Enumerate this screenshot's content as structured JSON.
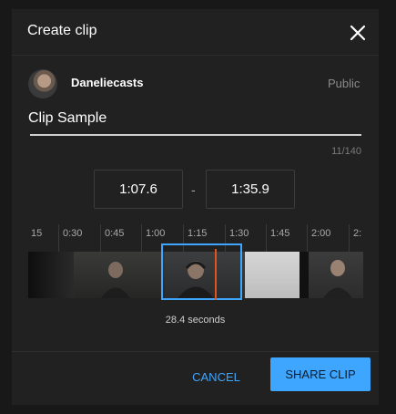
{
  "dialog": {
    "title": "Create clip",
    "channel_name": "Daneliecasts",
    "visibility": "Public",
    "clip_title_value": "Clip Sample",
    "char_count": "11/140",
    "start_time": "1:07.6",
    "separator": "-",
    "end_time": "1:35.9",
    "timeline_ticks": [
      "15",
      "0:30",
      "0:45",
      "1:00",
      "1:15",
      "1:30",
      "1:45",
      "2:00",
      "2:"
    ],
    "duration": "28.4 seconds",
    "cancel_label": "CANCEL",
    "share_label": "SHARE CLIP"
  },
  "colors": {
    "accent": "#3ea6ff",
    "playhead": "#e2541d",
    "background": "#212121"
  },
  "icons": {
    "close": "close-icon"
  }
}
